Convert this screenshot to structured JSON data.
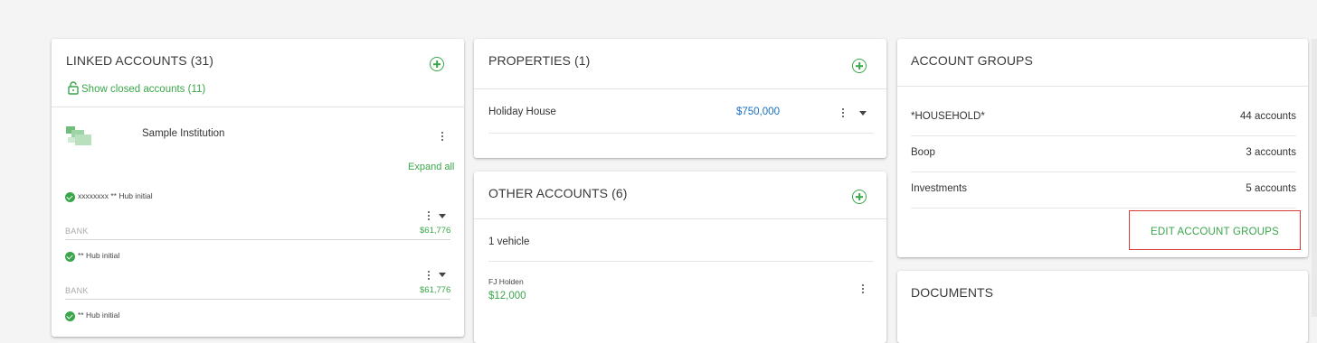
{
  "linked_accounts": {
    "title": "LINKED ACCOUNTS (31)",
    "show_closed": "Show closed accounts (11)",
    "institution": "Sample Institution",
    "expand_all": "Expand all",
    "accounts": [
      {
        "name": "xxxxxxxx ** Hub initial",
        "type": "BANK",
        "value": "$61,776"
      },
      {
        "name": "** Hub initial",
        "type": "BANK",
        "value": "$61,776"
      },
      {
        "name": "** Hub initial"
      }
    ]
  },
  "properties": {
    "title": "PROPERTIES (1)",
    "items": [
      {
        "name": "Holiday House",
        "value": "$750,000"
      }
    ]
  },
  "other_accounts": {
    "title": "OTHER ACCOUNTS (6)",
    "group_label": "1 vehicle",
    "items": [
      {
        "name": "FJ Holden",
        "value": "$12,000"
      }
    ]
  },
  "account_groups": {
    "title": "ACCOUNT GROUPS",
    "groups": [
      {
        "name": "*HOUSEHOLD*",
        "count": "44 accounts"
      },
      {
        "name": "Boop",
        "count": "3 accounts"
      },
      {
        "name": "Investments",
        "count": "5 accounts"
      }
    ],
    "edit_button": "EDIT ACCOUNT GROUPS"
  },
  "documents": {
    "title": "DOCUMENTS"
  },
  "colors": {
    "accent_green": "#3aa64a",
    "value_blue": "#1a6fc4",
    "highlight_red": "#d93b3b"
  }
}
